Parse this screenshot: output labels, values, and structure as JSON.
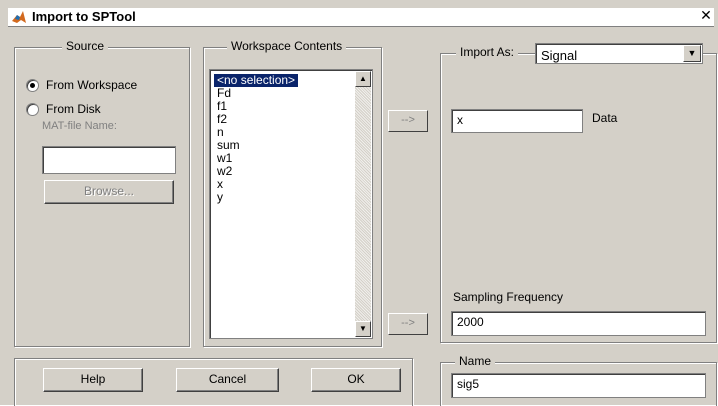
{
  "window": {
    "title": "Import to SPTool",
    "close_glyph": "✕"
  },
  "source": {
    "legend": "Source",
    "from_workspace": "From Workspace",
    "from_disk": "From Disk",
    "matfile_label": "MAT-file Name:",
    "matfile_value": "",
    "browse_label": "Browse...",
    "selected": "from_workspace"
  },
  "workspace": {
    "legend": "Workspace Contents",
    "items": [
      "<no selection>",
      "Fd",
      "f1",
      "f2",
      "n",
      "sum",
      "w1",
      "w2",
      "x",
      "y"
    ],
    "selected_index": 0
  },
  "arrows": {
    "data_arrow": "-->",
    "fs_arrow": "-->"
  },
  "import_as": {
    "label": "Import As:",
    "value": "Signal",
    "data_value": "x",
    "data_label": "Data",
    "fs_label": "Sampling Frequency",
    "fs_value": "2000"
  },
  "name": {
    "legend": "Name",
    "value": "sig5"
  },
  "buttons": {
    "help": "Help",
    "cancel": "Cancel",
    "ok": "OK"
  }
}
